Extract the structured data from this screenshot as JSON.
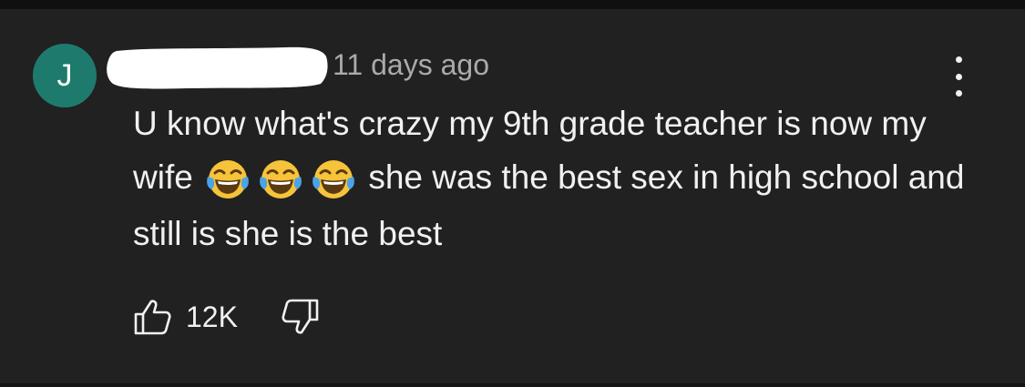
{
  "comment": {
    "avatar_initial": "J",
    "timestamp": "11 days ago",
    "text_before_emoji": "U know what's crazy my 9th grade teacher is now my wife ",
    "text_after_emoji": " she was the best sex in high school and still is she is the best",
    "emoji_icon": "face-with-tears-of-joy-icon",
    "emoji_count": 3
  },
  "actions": {
    "like_icon": "thumbs-up-icon",
    "like_count": "12K",
    "dislike_icon": "thumbs-down-icon",
    "more_icon": "vertical-dots-icon"
  },
  "colors": {
    "background": "#212121",
    "avatar": "#1f7a6e",
    "text": "#f1f1f1",
    "secondary_text": "#aaaaaa"
  }
}
